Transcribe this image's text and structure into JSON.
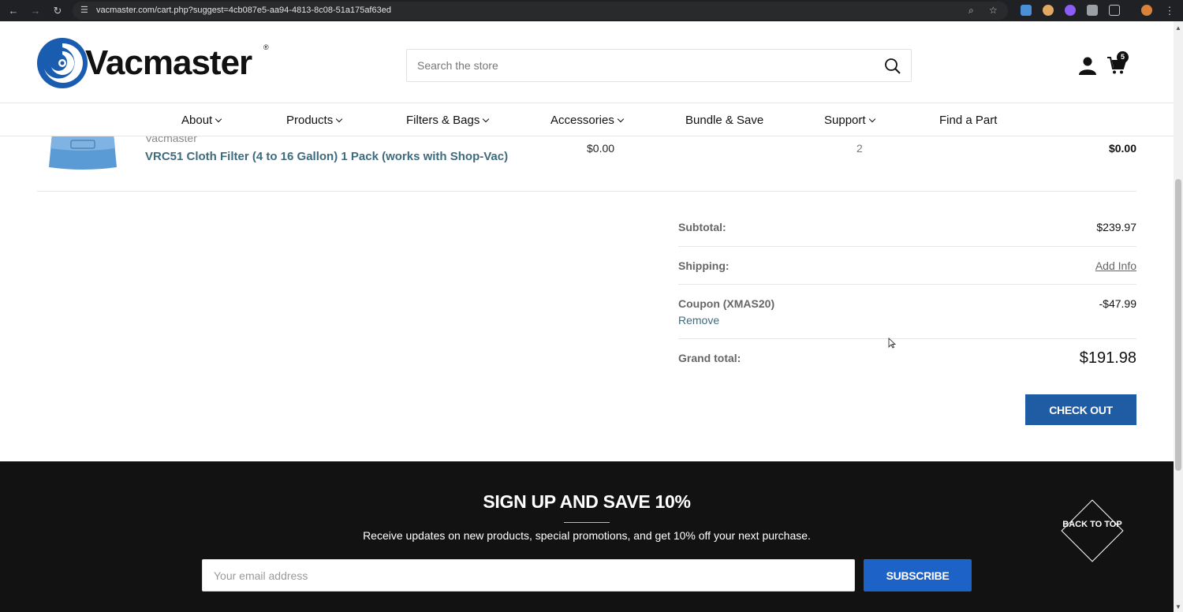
{
  "browser": {
    "url": "vacmaster.com/cart.php?suggest=4cb087e5-aa94-4813-8c08-51a175af63ed"
  },
  "header": {
    "logo_text": "Vacmaster",
    "logo_reg": "®",
    "search_placeholder": "Search the store",
    "cart_count": "5"
  },
  "nav": {
    "items": [
      {
        "label": "About",
        "dropdown": true
      },
      {
        "label": "Products",
        "dropdown": true
      },
      {
        "label": "Filters & Bags",
        "dropdown": true
      },
      {
        "label": "Accessories",
        "dropdown": true
      },
      {
        "label": "Bundle & Save",
        "dropdown": false
      },
      {
        "label": "Support",
        "dropdown": true
      },
      {
        "label": "Find a Part",
        "dropdown": false
      }
    ]
  },
  "cart_item": {
    "brand": "Vacmaster",
    "title": "VRC51 Cloth Filter (4 to 16 Gallon) 1 Pack (works with Shop-Vac)",
    "price": "$0.00",
    "quantity": "2",
    "total": "$0.00"
  },
  "totals": {
    "subtotal_label": "Subtotal:",
    "subtotal_value": "$239.97",
    "shipping_label": "Shipping:",
    "shipping_value": "Add Info",
    "coupon_label": "Coupon (XMAS20)",
    "coupon_value": "-$47.99",
    "coupon_remove": "Remove",
    "grand_label": "Grand total:",
    "grand_value": "$191.98",
    "checkout_label": "CHECK OUT"
  },
  "footer": {
    "signup_title": "SIGN UP AND SAVE 10%",
    "signup_text": "Receive updates on new products, special promotions, and get 10% off your next purchase.",
    "email_placeholder": "Your email address",
    "subscribe_label": "SUBSCRIBE",
    "back_to_top": "BACK TO TOP"
  },
  "colors": {
    "accent_blue": "#1f5ca3",
    "link_teal": "#3f6b7e",
    "footer_bg": "#121212"
  }
}
